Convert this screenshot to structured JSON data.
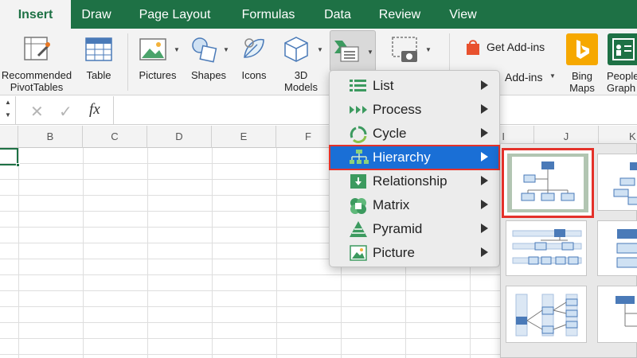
{
  "tabs": [
    {
      "label": "Insert",
      "active": true
    },
    {
      "label": "Draw"
    },
    {
      "label": "Page Layout"
    },
    {
      "label": "Formulas"
    },
    {
      "label": "Data"
    },
    {
      "label": "Review"
    },
    {
      "label": "View"
    }
  ],
  "ribbon": {
    "recommended_pivot": "Recommended\nPivotTables",
    "table": "Table",
    "pictures": "Pictures",
    "shapes": "Shapes",
    "icons": "Icons",
    "models_3d": "3D\nModels",
    "get_addins": "Get Add-ins",
    "my_addins": "Add-ins",
    "bing_maps": "Bing\nMaps",
    "people_graph": "People\nGraph"
  },
  "formula_bar": {
    "cancel_glyph": "✕",
    "enter_glyph": "✓",
    "fx_label": "fx",
    "value": ""
  },
  "columns": [
    "B",
    "C",
    "D",
    "E",
    "F",
    "I",
    "J",
    "K"
  ],
  "smartart_menu": {
    "items": [
      {
        "label": "List",
        "icon": "list-icon"
      },
      {
        "label": "Process",
        "icon": "process-icon"
      },
      {
        "label": "Cycle",
        "icon": "cycle-icon"
      },
      {
        "label": "Hierarchy",
        "icon": "hierarchy-icon",
        "selected": true
      },
      {
        "label": "Relationship",
        "icon": "relationship-icon"
      },
      {
        "label": "Matrix",
        "icon": "matrix-icon"
      },
      {
        "label": "Pyramid",
        "icon": "pyramid-icon"
      },
      {
        "label": "Picture",
        "icon": "picture-icon"
      }
    ]
  },
  "colors": {
    "brand_green": "#1e7145",
    "selection_blue": "#1a6fd6",
    "highlight_red": "#e4312a",
    "diagram_blue": "#4a7ab8"
  }
}
